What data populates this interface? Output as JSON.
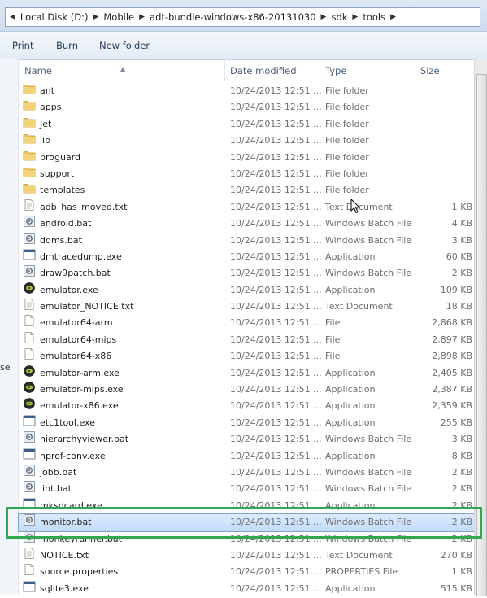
{
  "breadcrumb": [
    "Local Disk (D:)",
    "Mobile",
    "adt-bundle-windows-x86-20131030",
    "sdk",
    "tools"
  ],
  "toolbar": {
    "print": "Print",
    "burn": "Burn",
    "new_folder": "New folder"
  },
  "nav_fragment": "se",
  "columns": {
    "name": "Name",
    "date": "Date modified",
    "type": "Type",
    "size": "Size"
  },
  "colors": {
    "highlight_box": "#2fa84f",
    "selected_row": "#cce4fc",
    "folder": "#e8c15a"
  },
  "files": [
    {
      "name": "ant",
      "date": "10/24/2013 12:51 ...",
      "type": "File folder",
      "size": "",
      "icon": "folder-icon"
    },
    {
      "name": "apps",
      "date": "10/24/2013 12:51 ...",
      "type": "File folder",
      "size": "",
      "icon": "folder-icon"
    },
    {
      "name": "Jet",
      "date": "10/24/2013 12:51 ...",
      "type": "File folder",
      "size": "",
      "icon": "folder-icon"
    },
    {
      "name": "lib",
      "date": "10/24/2013 12:51 ...",
      "type": "File folder",
      "size": "",
      "icon": "folder-icon"
    },
    {
      "name": "proguard",
      "date": "10/24/2013 12:51 ...",
      "type": "File folder",
      "size": "",
      "icon": "folder-icon"
    },
    {
      "name": "support",
      "date": "10/24/2013 12:51 ...",
      "type": "File folder",
      "size": "",
      "icon": "folder-icon"
    },
    {
      "name": "templates",
      "date": "10/24/2013 12:51 ...",
      "type": "File folder",
      "size": "",
      "icon": "folder-icon"
    },
    {
      "name": "adb_has_moved.txt",
      "date": "10/24/2013 12:51 ...",
      "type": "Text Document",
      "size": "1 KB",
      "icon": "text-file-icon"
    },
    {
      "name": "android.bat",
      "date": "10/24/2013 12:51 ...",
      "type": "Windows Batch File",
      "size": "4 KB",
      "icon": "batch-file-icon"
    },
    {
      "name": "ddms.bat",
      "date": "10/24/2013 12:51 ...",
      "type": "Windows Batch File",
      "size": "3 KB",
      "icon": "batch-file-icon"
    },
    {
      "name": "dmtracedump.exe",
      "date": "10/24/2013 12:51 ...",
      "type": "Application",
      "size": "60 KB",
      "icon": "app-window-icon"
    },
    {
      "name": "draw9patch.bat",
      "date": "10/24/2013 12:51 ...",
      "type": "Windows Batch File",
      "size": "2 KB",
      "icon": "batch-file-icon"
    },
    {
      "name": "emulator.exe",
      "date": "10/24/2013 12:51 ...",
      "type": "Application",
      "size": "109 KB",
      "icon": "emulator-icon"
    },
    {
      "name": "emulator_NOTICE.txt",
      "date": "10/24/2013 12:51 ...",
      "type": "Text Document",
      "size": "18 KB",
      "icon": "text-file-icon"
    },
    {
      "name": "emulator64-arm",
      "date": "10/24/2013 12:51 ...",
      "type": "File",
      "size": "2,868 KB",
      "icon": "blank-file-icon"
    },
    {
      "name": "emulator64-mips",
      "date": "10/24/2013 12:51 ...",
      "type": "File",
      "size": "2,897 KB",
      "icon": "blank-file-icon"
    },
    {
      "name": "emulator64-x86",
      "date": "10/24/2013 12:51 ...",
      "type": "File",
      "size": "2,898 KB",
      "icon": "blank-file-icon"
    },
    {
      "name": "emulator-arm.exe",
      "date": "10/24/2013 12:51 ...",
      "type": "Application",
      "size": "2,405 KB",
      "icon": "emulator-icon"
    },
    {
      "name": "emulator-mips.exe",
      "date": "10/24/2013 12:51 ...",
      "type": "Application",
      "size": "2,387 KB",
      "icon": "emulator-icon"
    },
    {
      "name": "emulator-x86.exe",
      "date": "10/24/2013 12:51 ...",
      "type": "Application",
      "size": "2,359 KB",
      "icon": "emulator-icon"
    },
    {
      "name": "etc1tool.exe",
      "date": "10/24/2013 12:51 ...",
      "type": "Application",
      "size": "255 KB",
      "icon": "app-window-icon"
    },
    {
      "name": "hierarchyviewer.bat",
      "date": "10/24/2013 12:51 ...",
      "type": "Windows Batch File",
      "size": "3 KB",
      "icon": "batch-file-icon"
    },
    {
      "name": "hprof-conv.exe",
      "date": "10/24/2013 12:51 ...",
      "type": "Application",
      "size": "8 KB",
      "icon": "app-window-icon"
    },
    {
      "name": "jobb.bat",
      "date": "10/24/2013 12:51 ...",
      "type": "Windows Batch File",
      "size": "2 KB",
      "icon": "batch-file-icon"
    },
    {
      "name": "lint.bat",
      "date": "10/24/2013 12:51 ...",
      "type": "Windows Batch File",
      "size": "2 KB",
      "icon": "batch-file-icon"
    },
    {
      "name": "mksdcard.exe",
      "date": "10/24/2013 12:51 ...",
      "type": "Application",
      "size": "2 KB",
      "icon": "app-window-icon"
    },
    {
      "name": "monitor.bat",
      "date": "10/24/2013 12:51 ...",
      "type": "Windows Batch File",
      "size": "2 KB",
      "icon": "batch-file-icon",
      "selected": true
    },
    {
      "name": "monkeyrunner.bat",
      "date": "10/24/2013 12:51 ...",
      "type": "Windows Batch File",
      "size": "2 KB",
      "icon": "batch-file-icon"
    },
    {
      "name": "NOTICE.txt",
      "date": "10/24/2013 12:51 ...",
      "type": "Text Document",
      "size": "270 KB",
      "icon": "text-file-icon"
    },
    {
      "name": "source.properties",
      "date": "10/24/2013 12:51 ...",
      "type": "PROPERTIES File",
      "size": "1 KB",
      "icon": "blank-file-icon"
    },
    {
      "name": "sqlite3.exe",
      "date": "10/24/2013 12:51 ...",
      "type": "Application",
      "size": "515 KB",
      "icon": "app-window-icon"
    }
  ]
}
